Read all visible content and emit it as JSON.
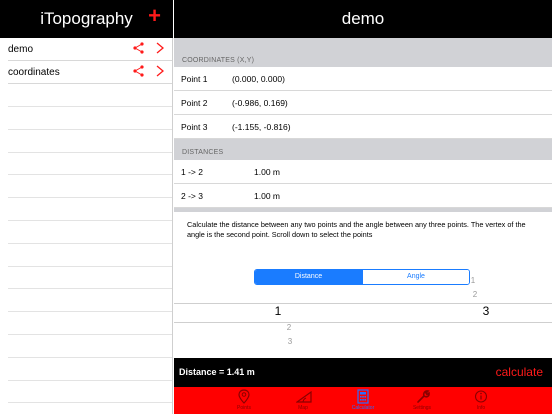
{
  "sidebar": {
    "title": "iTopography",
    "add_label": "+",
    "items": [
      {
        "label": "demo"
      },
      {
        "label": "coordinates"
      }
    ]
  },
  "main": {
    "title": "demo",
    "coordinates": {
      "header": "COORDINATES (X,Y)",
      "rows": [
        {
          "name": "Point 1",
          "value": "(0.000, 0.000)"
        },
        {
          "name": "Point 2",
          "value": "(-0.986, 0.169)"
        },
        {
          "name": "Point 3",
          "value": "(-1.155, -0.816)"
        }
      ]
    },
    "distances": {
      "header": "DISTANCES",
      "rows": [
        {
          "name": "1 -> 2",
          "value": "1.00 m"
        },
        {
          "name": "2 -> 3",
          "value": "1.00 m"
        }
      ]
    },
    "description": "Calculate the distance between any two points and the angle between any three points.  The vertex of the angle is the second point. Scroll down to select the points",
    "segment": {
      "distance": "Distance",
      "angle": "Angle",
      "selected": "Distance"
    },
    "picker": {
      "col1": [
        "1",
        "2",
        "3"
      ],
      "col2": [
        "1",
        "2",
        "3"
      ],
      "selected": [
        "1",
        "3"
      ]
    },
    "result": "Distance =  1.41 m",
    "calculate_label": "calculate"
  },
  "tabbar": {
    "tabs": [
      {
        "label": "Points",
        "icon": "pin-icon"
      },
      {
        "label": "Map",
        "icon": "protractor-icon"
      },
      {
        "label": "Calculator",
        "icon": "calculator-icon",
        "active": true
      },
      {
        "label": "Settings",
        "icon": "wrench-icon"
      },
      {
        "label": "Info",
        "icon": "info-icon"
      }
    ]
  },
  "colors": {
    "accent": "#ff1a1a",
    "tab_active": "#2b6cff",
    "segment": "#1a7cff"
  }
}
